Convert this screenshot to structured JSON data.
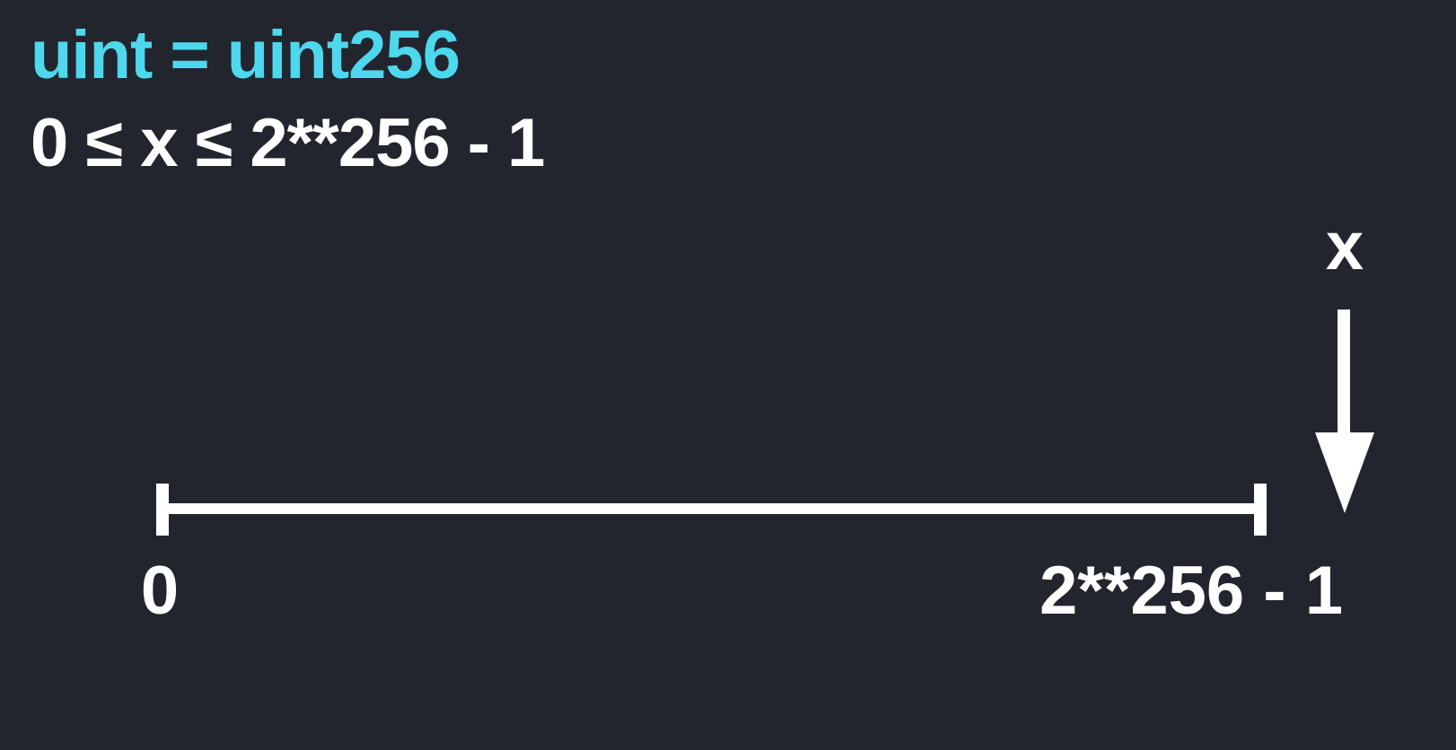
{
  "title": "uint = uint256",
  "range": "0 ≤ x ≤ 2**256 - 1",
  "number_line": {
    "min_label": "0",
    "max_label": "2**256 - 1",
    "pointer_label": "x"
  },
  "colors": {
    "background": "#22252e",
    "title": "#4dd8ee",
    "text": "#ffffff",
    "line": "#ffffff"
  },
  "icons": {
    "pointer": "down-arrow-icon"
  }
}
